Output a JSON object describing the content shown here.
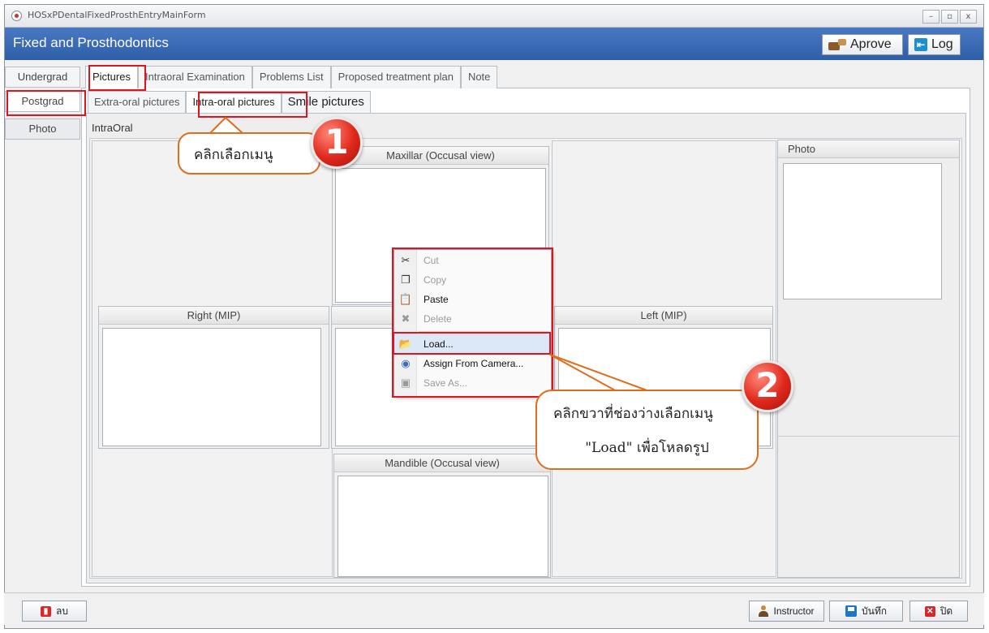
{
  "window": {
    "title": "HOSxPDentalFixedProsthEntryMainForm",
    "minimize": "–",
    "maximize": "▫",
    "close": "x"
  },
  "header": {
    "title": "Fixed and Prosthodontics",
    "aprove_label": "Aprove",
    "log_label": "Log"
  },
  "side_tabs": [
    "Undergrad",
    "Postgrad",
    "Photo"
  ],
  "tabs": [
    "Pictures",
    "Intraoral Examination",
    "Problems List",
    "Proposed treatment plan",
    "Note"
  ],
  "sub_tabs": [
    "Extra-oral pictures",
    "Intra-oral pictures",
    "Smile pictures"
  ],
  "intraoral": {
    "label": "IntraOral",
    "maxillar": "Maxillar (Occusal view)",
    "right": "Right (MIP)",
    "left": "Left (MIP)",
    "mandible": "Mandible (Occusal view)",
    "photo": "Photo"
  },
  "context_menu": {
    "items": [
      {
        "label": "Cut",
        "icon": "scissors-icon"
      },
      {
        "label": "Copy",
        "icon": "copy-icon"
      },
      {
        "label": "Paste",
        "icon": "paste-icon"
      },
      {
        "label": "Delete",
        "icon": "delete-icon"
      },
      {
        "label": "Load...",
        "icon": "folder-icon"
      },
      {
        "label": "Assign From Camera...",
        "icon": "camera-icon"
      },
      {
        "label": "Save As...",
        "icon": "save-icon"
      }
    ]
  },
  "callouts": {
    "step1_number": "1",
    "step1_text": "คลิกเลือกเมนู",
    "step2_number": "2",
    "step2_line1": "คลิกขวาที่ช่องว่างเลือกเมนู",
    "step2_line2": "\"Load\" เพื่อโหลดรูป"
  },
  "footer": {
    "delete_label": "ลบ",
    "instructor_label": "Instructor",
    "save_label": "บันทึก",
    "close_label": "ปิด"
  },
  "colors": {
    "header_blue": "#2f5ea8",
    "highlight_red": "#e0141e",
    "callout_orange": "#e06c1e"
  }
}
